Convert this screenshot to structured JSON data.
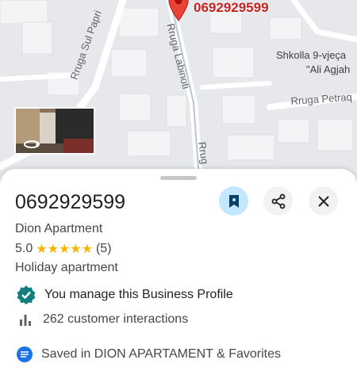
{
  "map": {
    "pin_label": "0692929599",
    "streets": {
      "sul_papri": "Rruga Sul Papri",
      "labinoti": "Rruga Labinoti",
      "petraq": "Rruga Petraq",
      "rrug_cut": "Rrug"
    },
    "place_line1": "Shkolla 9-vjeça",
    "place_line2": "\"Ali Agjah"
  },
  "sheet": {
    "title": "0692929599",
    "name": "Dion Apartment",
    "rating": "5.0",
    "stars": "★★★★★",
    "review_count": "(5)",
    "category": "Holiday apartment",
    "manage_text": "You manage this Business Profile",
    "interactions_text": "262 customer interactions",
    "saved_text": "Saved in DION APARTAMENT & Favorites"
  },
  "colors": {
    "accent_save_bg": "#c2e7ff",
    "verified_teal": "#137e7e",
    "star_gold": "#f7b500",
    "pin_red": "#ea4335"
  },
  "icons": [
    "bookmark-icon",
    "share-icon",
    "close-icon",
    "verified-badge-icon",
    "bar-chart-icon",
    "saved-list-icon",
    "map-pin-icon",
    "street-view-360-icon"
  ]
}
